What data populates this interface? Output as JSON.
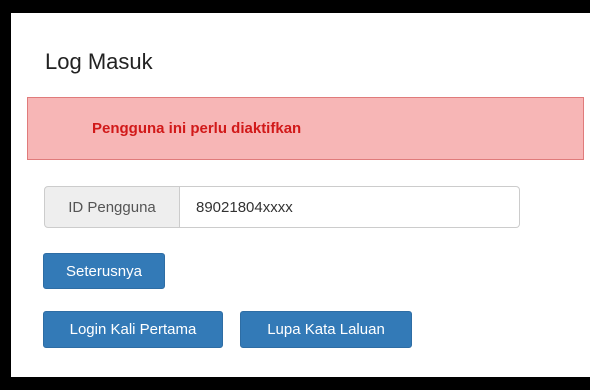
{
  "page": {
    "title": "Log Masuk"
  },
  "alert": {
    "message": "Pengguna ini perlu diaktifkan"
  },
  "user_id": {
    "label": "ID Pengguna",
    "value": "89021804xxxx"
  },
  "buttons": {
    "next": "Seterusnya",
    "first_login": "Login Kali Pertama",
    "forgot_password": "Lupa Kata Laluan"
  },
  "colors": {
    "primary_button": "#337ab7",
    "alert_background": "#f7b6b6",
    "alert_text": "#d11919"
  }
}
